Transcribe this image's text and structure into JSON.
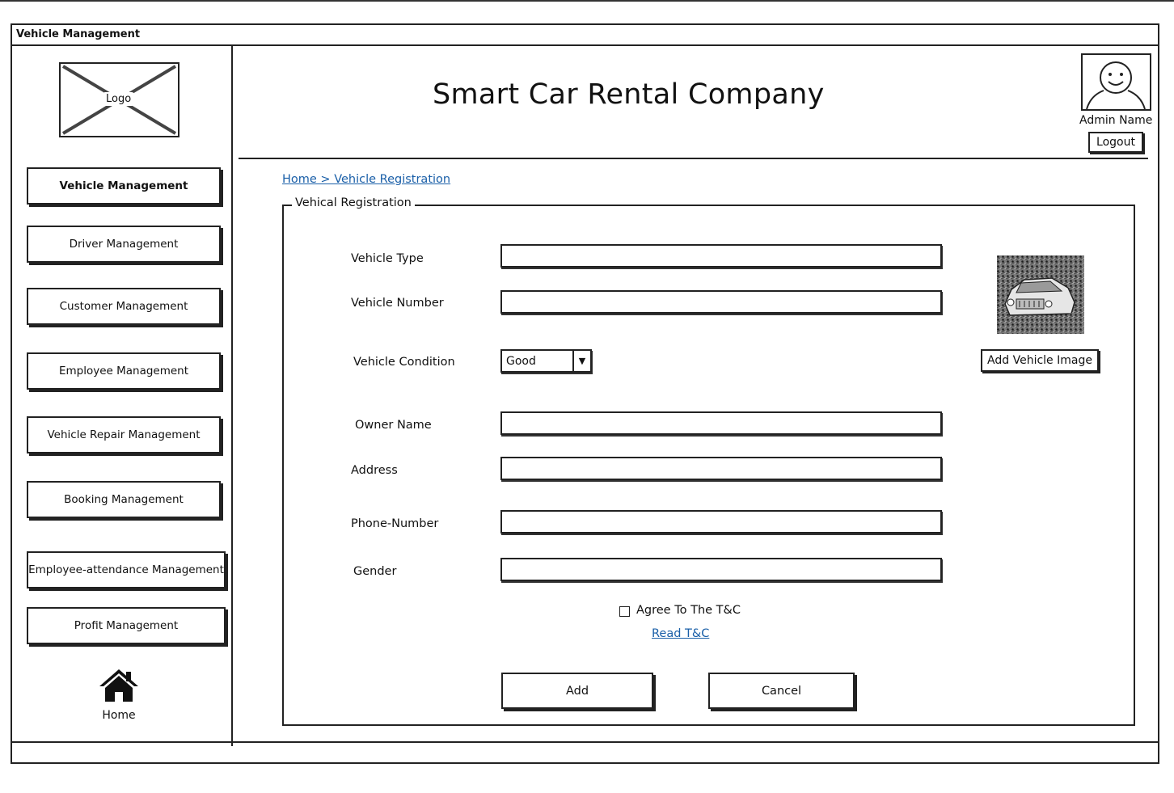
{
  "window": {
    "title": "Vehicle Management"
  },
  "logo": {
    "label": "Logo"
  },
  "sidebar": {
    "items": [
      {
        "label": "Vehicle Management",
        "active": true
      },
      {
        "label": "Driver Management",
        "active": false
      },
      {
        "label": "Customer Management",
        "active": false
      },
      {
        "label": "Employee Management",
        "active": false
      },
      {
        "label": "Vehicle Repair Management",
        "active": false
      },
      {
        "label": "Booking Management",
        "active": false
      },
      {
        "label": "Employee-attendance Management",
        "active": false
      },
      {
        "label": "Profit Management",
        "active": false
      }
    ],
    "home": {
      "label": "Home",
      "icon": "home-icon"
    }
  },
  "header": {
    "company": "Smart Car Rental Company",
    "admin_name": "Admin Name",
    "logout_label": "Logout",
    "avatar_icon": "user-avatar-icon"
  },
  "breadcrumb": "Home > Vehicle Registration",
  "form": {
    "legend": "Vehical Registration",
    "fields": {
      "vehicle_type": {
        "label": "Vehicle Type",
        "value": ""
      },
      "vehicle_number": {
        "label": "Vehicle Number",
        "value": ""
      },
      "vehicle_condition": {
        "label": "Vehicle Condition",
        "value": "Good"
      },
      "owner_name": {
        "label": "Owner Name",
        "value": ""
      },
      "address": {
        "label": "Address",
        "value": ""
      },
      "phone_number": {
        "label": "Phone-Number",
        "value": ""
      },
      "gender": {
        "label": "Gender",
        "value": ""
      }
    },
    "add_image_label": "Add Vehicle Image",
    "agree_label": "Agree To The T&C",
    "agree_checked": false,
    "tc_link": "Read T&C",
    "add_label": "Add",
    "cancel_label": "Cancel"
  }
}
